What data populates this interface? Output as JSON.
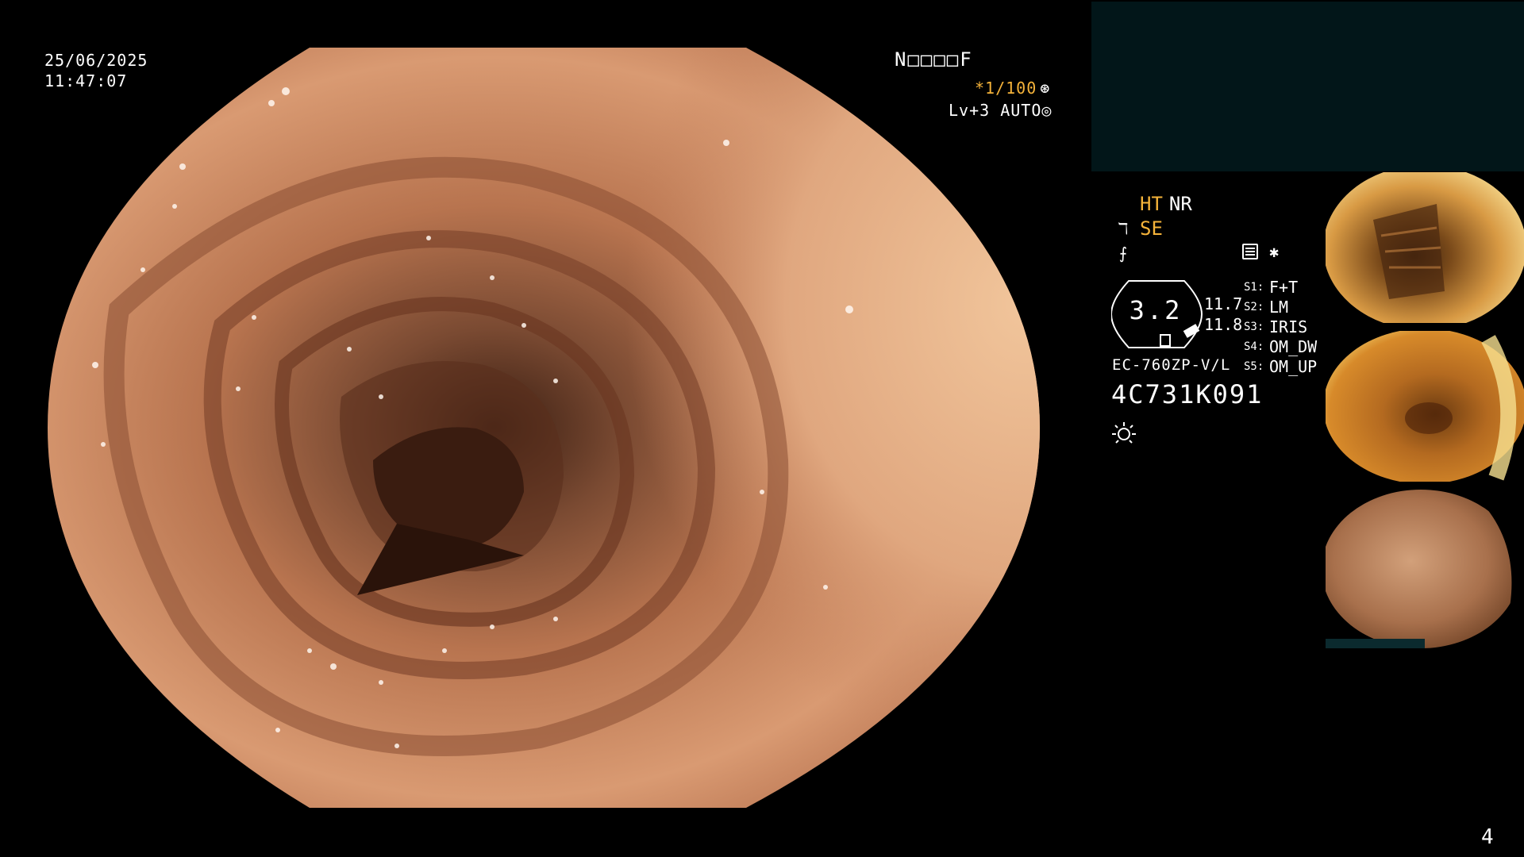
{
  "osd": {
    "date": "25/06/2025",
    "time": "11:47:07",
    "patient_id": "N□□□□F",
    "shutter": "*1/100",
    "level": "Lv+3 AUTO"
  },
  "modes": {
    "ht": "HT",
    "nr": "NR",
    "se": "SE"
  },
  "zoom": {
    "value": "3.2",
    "scale_top": "11.7",
    "scale_bottom": "11.8"
  },
  "switches": [
    {
      "key": "S1:",
      "label": "F+T"
    },
    {
      "key": "S2:",
      "label": "LM"
    },
    {
      "key": "S3:",
      "label": "IRIS"
    },
    {
      "key": "S4:",
      "label": "OM_DW"
    },
    {
      "key": "S5:",
      "label": "OM_UP"
    }
  ],
  "scope": {
    "model": "EC-760ZP-V/L",
    "serial": "4C731K091"
  },
  "icons": {
    "shutter": "aperture-icon",
    "level": "auto-iris-icon",
    "se": "enhancement-icon",
    "f": "filter-icon",
    "keyboard": "keyboard-icon",
    "star": "asterisk-icon",
    "light": "light-icon"
  },
  "page": {
    "number": "4"
  },
  "colors": {
    "osd_accent": "#f5b33a",
    "panel_bg": "#021619"
  }
}
